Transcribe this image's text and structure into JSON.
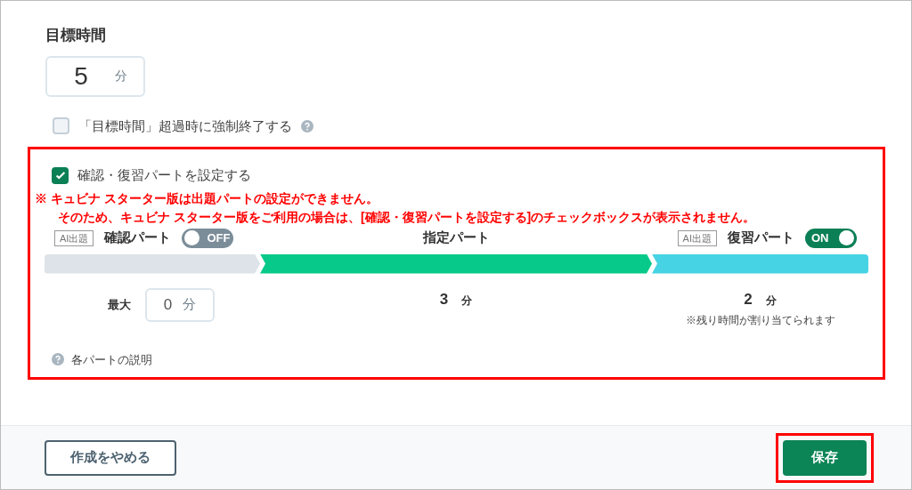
{
  "target_time": {
    "title": "目標時間",
    "value": "5",
    "unit": "分"
  },
  "force_end": {
    "label": "「目標時間」超過時に強制終了する",
    "checked": false
  },
  "parts_setting": {
    "label": "確認・復習パートを設定する",
    "checked": true,
    "highlighted": true
  },
  "notice": [
    "※ キュビナ スターター版は出題パートの設定ができません。",
    "そのため、キュビナ スターター版をご利用の場合は、[確認・復習パートを設定する]のチェックボックスが表示されません。"
  ],
  "parts": [
    {
      "kind": "input",
      "ai_badge": "AI出題",
      "label": "確認パート",
      "toggle": {
        "on": false,
        "label": "OFF"
      },
      "color": "#dde3e8",
      "prefix": "最大",
      "value": "0",
      "unit": "分"
    },
    {
      "kind": "fixed",
      "label": "指定パート",
      "color": "#06c98a",
      "value": "3",
      "unit": "分"
    },
    {
      "kind": "fixed",
      "ai_badge": "AI出題",
      "label": "復習パート",
      "toggle": {
        "on": true,
        "label": "ON"
      },
      "color": "#46d4e4",
      "value": "2",
      "unit": "分",
      "note": "※残り時間が割り当てられます"
    }
  ],
  "help_link": "各パートの説明",
  "footer": {
    "cancel": "作成をやめる",
    "save": "保存",
    "save_highlighted": true
  }
}
